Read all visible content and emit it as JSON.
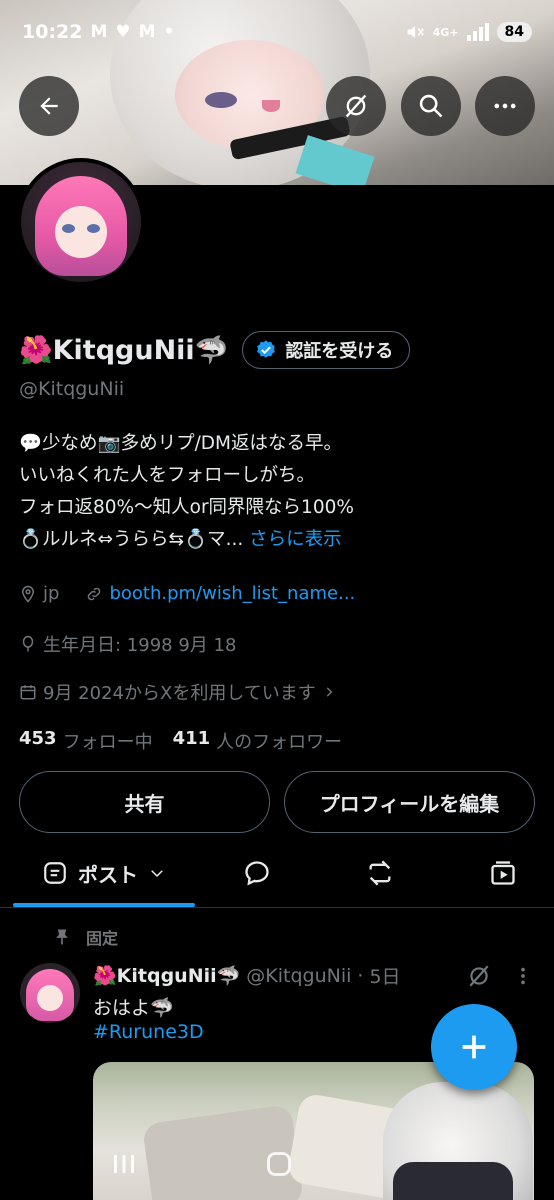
{
  "status_bar": {
    "time": "10:22",
    "notifications": [
      "M",
      "♥",
      "M",
      "•"
    ],
    "network": "4G+",
    "battery": "84"
  },
  "profile": {
    "display_name": "🌺KitqguNii🦈",
    "verify_button": "認証を受ける",
    "handle": "@KitqguNii",
    "bio_lines": [
      "💬少なめ📷多めリプ/DM返はなる早。",
      "いいねくれた人をフォローしがち。",
      "フォロ返80%〜知人or同界隈なら100%",
      "💍ルルネ⇔うらら⇆💍マ..."
    ],
    "bio_more": "さらに表示",
    "location": "jp",
    "website": "booth.pm/wish_list_name...",
    "birthday": "生年月日: 1998 9月 18",
    "joined": "9月 2024からXを利用しています",
    "following_count": "453",
    "following_label": "フォロー中",
    "followers_count": "411",
    "followers_label": "人のフォロワー"
  },
  "actions": {
    "share": "共有",
    "edit_profile": "プロフィールを編集"
  },
  "tabs": {
    "posts": "ポスト"
  },
  "pinned_post": {
    "pinned_label": "固定",
    "author_name": "🌺KitqguNii🦈",
    "author_handle": "@KitqguNii",
    "time": "5日",
    "text": "おはよ🦈",
    "hashtag": "#Rurune3D"
  },
  "icons": {
    "back": "back-arrow-icon",
    "grok": "grok-icon",
    "search": "search-icon",
    "more": "more-icon",
    "verified": "verified-badge-icon",
    "location": "location-icon",
    "link": "link-icon",
    "birthday": "balloon-icon",
    "calendar": "calendar-icon",
    "fab": "plus-icon"
  },
  "colors": {
    "accent": "#1d9bf0",
    "background": "#000000",
    "text": "#e7e9ea",
    "secondary": "#71767b"
  }
}
